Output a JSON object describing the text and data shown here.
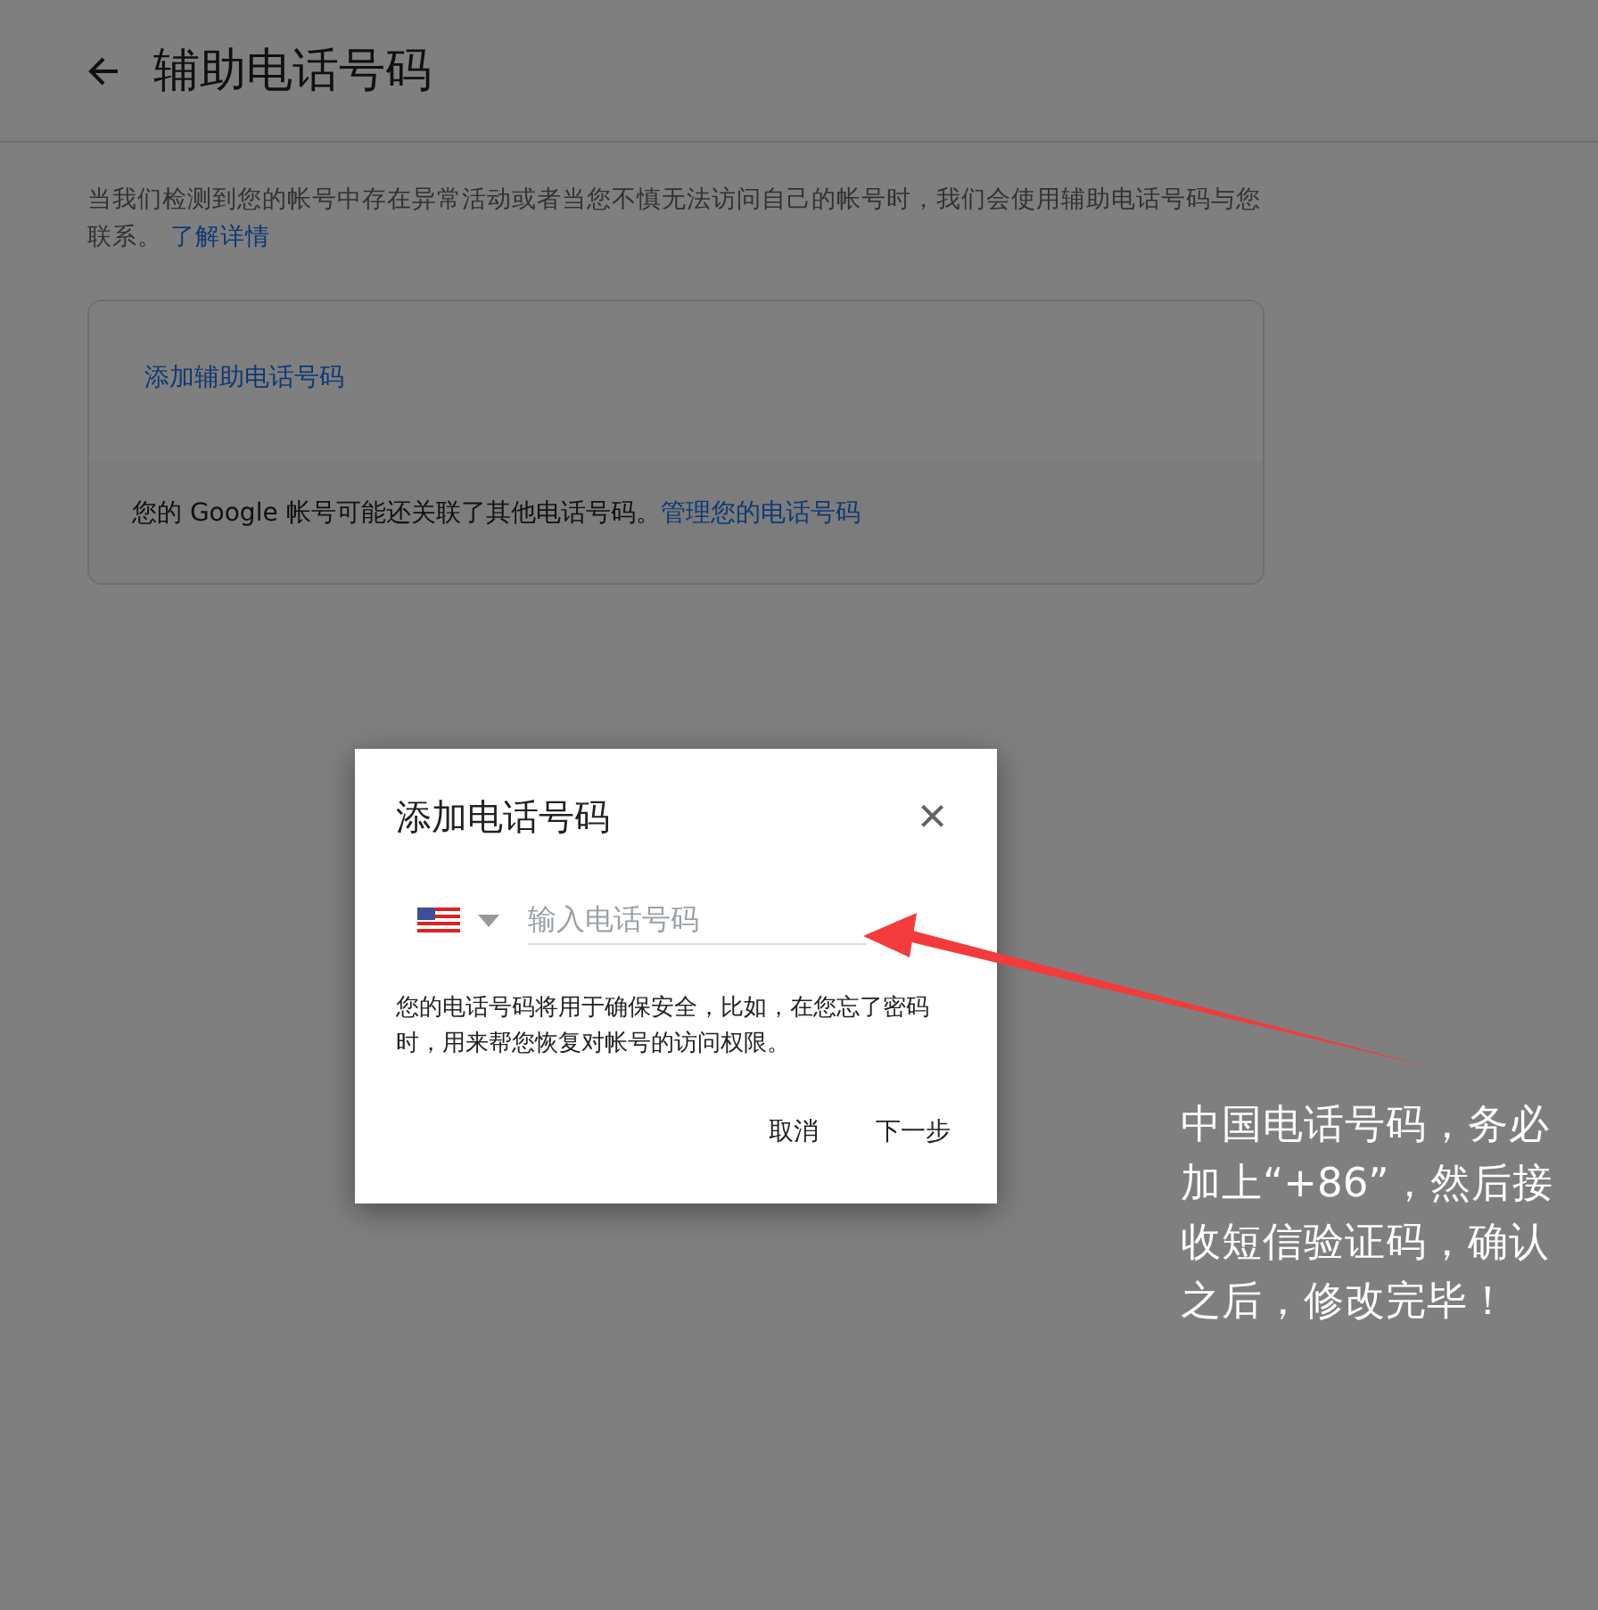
{
  "header": {
    "title": "辅助电话号码"
  },
  "description": {
    "text": "当我们检测到您的帐号中存在异常活动或者当您不慎无法访问自己的帐号时，我们会使用辅助电话号码与您联系。",
    "link": "了解详情"
  },
  "card": {
    "add_link": "添加辅助电话号码",
    "footer_text": "您的 Google 帐号可能还关联了其他电话号码。",
    "footer_link": "管理您的电话号码"
  },
  "dialog": {
    "title": "添加电话号码",
    "close": "×",
    "phone_field": {
      "placeholder": "输入电话号码"
    },
    "note": "您的电话号码将用于确保安全，比如，在您忘了密码时，用来帮您恢复对帐号的访问权限。",
    "buttons": [
      "取消",
      "下一步"
    ]
  },
  "annotation": {
    "text": "中国电话号码，务必加上“+86”，然后接收短信验证码，确认之后，修改完毕！"
  }
}
